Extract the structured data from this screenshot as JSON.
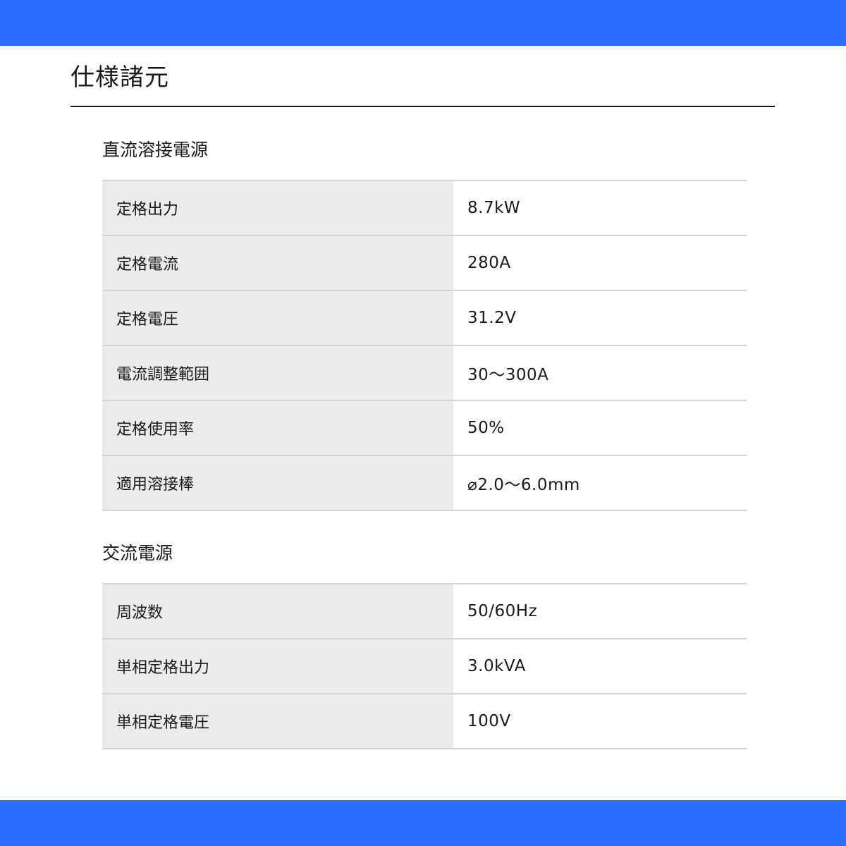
{
  "header": {
    "title": "仕様諸元"
  },
  "sections": [
    {
      "title": "直流溶接電源",
      "rows": [
        {
          "label": "定格出力",
          "value": "8.7kW"
        },
        {
          "label": "定格電流",
          "value": "280A"
        },
        {
          "label": "定格電圧",
          "value": "31.2V"
        },
        {
          "label": "電流調整範囲",
          "value": "30～300A"
        },
        {
          "label": "定格使用率",
          "value": "50%"
        },
        {
          "label": "適用溶接棒",
          "value": "⌀2.0～6.0mm"
        }
      ]
    },
    {
      "title": "交流電源",
      "rows": [
        {
          "label": "周波数",
          "value": "50/60Hz"
        },
        {
          "label": "単相定格出力",
          "value": "3.0kVA"
        },
        {
          "label": "単相定格電圧",
          "value": "100V"
        }
      ]
    }
  ],
  "colors": {
    "band": "#2b6cff",
    "label_bg": "#ebebeb",
    "rule": "#d4d4d4",
    "text": "#1a1a1a"
  }
}
